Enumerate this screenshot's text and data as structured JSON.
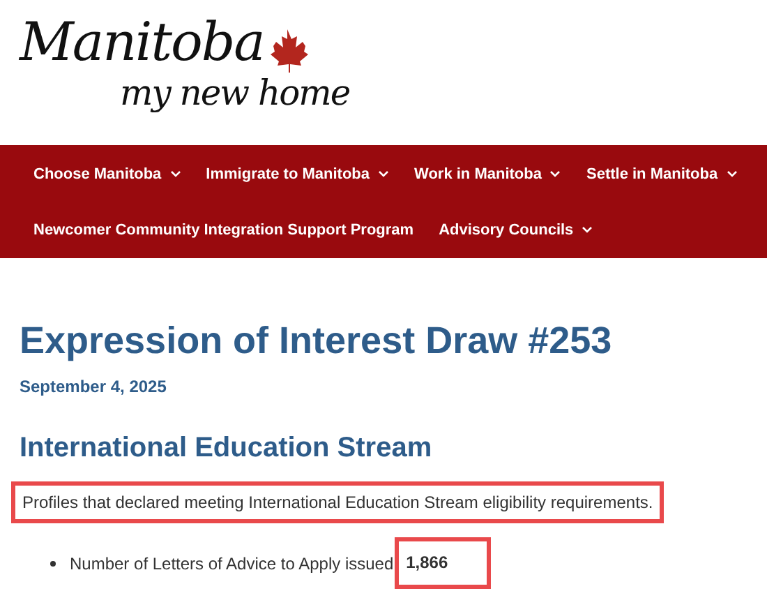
{
  "logo": {
    "title": "Manitoba",
    "tagline": "my new home"
  },
  "nav": {
    "items": [
      {
        "label": "Choose Manitoba",
        "has_menu": true
      },
      {
        "label": "Immigrate to Manitoba",
        "has_menu": true
      },
      {
        "label": "Work in Manitoba",
        "has_menu": true
      },
      {
        "label": "Settle in Manitoba",
        "has_menu": true
      },
      {
        "label": "Newcomer Community Integration Support Program",
        "has_menu": false
      },
      {
        "label": "Advisory Councils",
        "has_menu": true
      }
    ]
  },
  "article": {
    "title": "Expression of Interest Draw #253",
    "date": "September 4, 2025",
    "section_title": "International Education Stream",
    "intro": {
      "text": "Profiles that declared meeting International Education Stream eligibility requirements.",
      "highlighted": true
    },
    "bullets": [
      {
        "label": "Number of Letters of Advice to Apply issued",
        "value": "1,866",
        "highlighted": true
      }
    ]
  }
}
